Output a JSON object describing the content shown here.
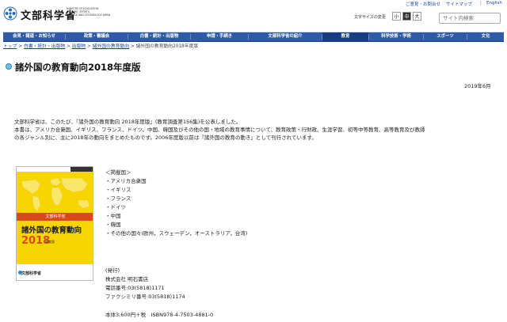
{
  "header": {
    "logo_text": "文部科学省",
    "logo_sub_lines": [
      "MINISTRY OF EDUCATION,",
      "CULTURE, SPORTS,",
      "SCIENCE AND TECHNOLOGY-JAPAN"
    ],
    "top_links": [
      "ご意見・お問合せ",
      "サイトマップ",
      "English"
    ],
    "font_size_label": "文字サイズの変更",
    "font_sizes": [
      "小",
      "中",
      "大"
    ],
    "search_placeholder": "サイト内検索"
  },
  "nav": {
    "items": [
      "会見・報道・お知らせ",
      "政策・審議会",
      "白書・統計・出版物",
      "申請・手続き",
      "文部科学省の紹介",
      "教育",
      "科学技術・学術",
      "スポーツ",
      "文化"
    ],
    "current": "教育"
  },
  "breadcrumb": {
    "items": [
      "トップ",
      "白書・統計・出版物",
      "出版物",
      "諸外国の教育動向"
    ],
    "current": "諸外国の教育動向2018年度版",
    "separator": ">"
  },
  "page": {
    "title": "諸外国の教育動向2018年度版",
    "date": "2019年6月",
    "paragraphs": [
      "文部科学省は、このたび、『諸外国の教育動向 2018年度版』(教育調査第156集)を公表しました。",
      "本書は、アメリカ合衆国、イギリス、フランス、ドイツ、中国、韓国及びその他の国・地域の教育事情について、教育政策・行財政、生涯学習、初等中等教育、高等教育及び教師",
      "の各ジャンル別に、主に2018年の動向をまとめたものです。2006年度版以前は『諸外国の教育の動き』として刊行されています。"
    ]
  },
  "cover": {
    "band_label": "文部科学省",
    "title": "諸外国の教育動向",
    "year": "2018",
    "year_suffix": "年度版",
    "logo": "文部科学省"
  },
  "info": {
    "countries_heading": "＜掲載国＞",
    "countries": [
      "・アメリカ合衆国",
      "・イギリス",
      "・フランス",
      "・ドイツ",
      "・中国",
      "・韓国",
      "・その他の国々(欧州，スウェーデン，オーストラリア，台湾)"
    ],
    "publisher_heading": "(発行)",
    "publisher": "株式会社 明石書店",
    "tel": "電話番号:03(5818)1171",
    "fax": "ファクシミリ番号:03(5818)1174",
    "price": "本体3,600円＋税　ISBN978-4-7503-4881-0"
  },
  "colors": {
    "nav_bg": "#2e5aa8",
    "link": "#1a3f9c",
    "cover_bg": "#f6d500",
    "accent": "#d94a18"
  }
}
